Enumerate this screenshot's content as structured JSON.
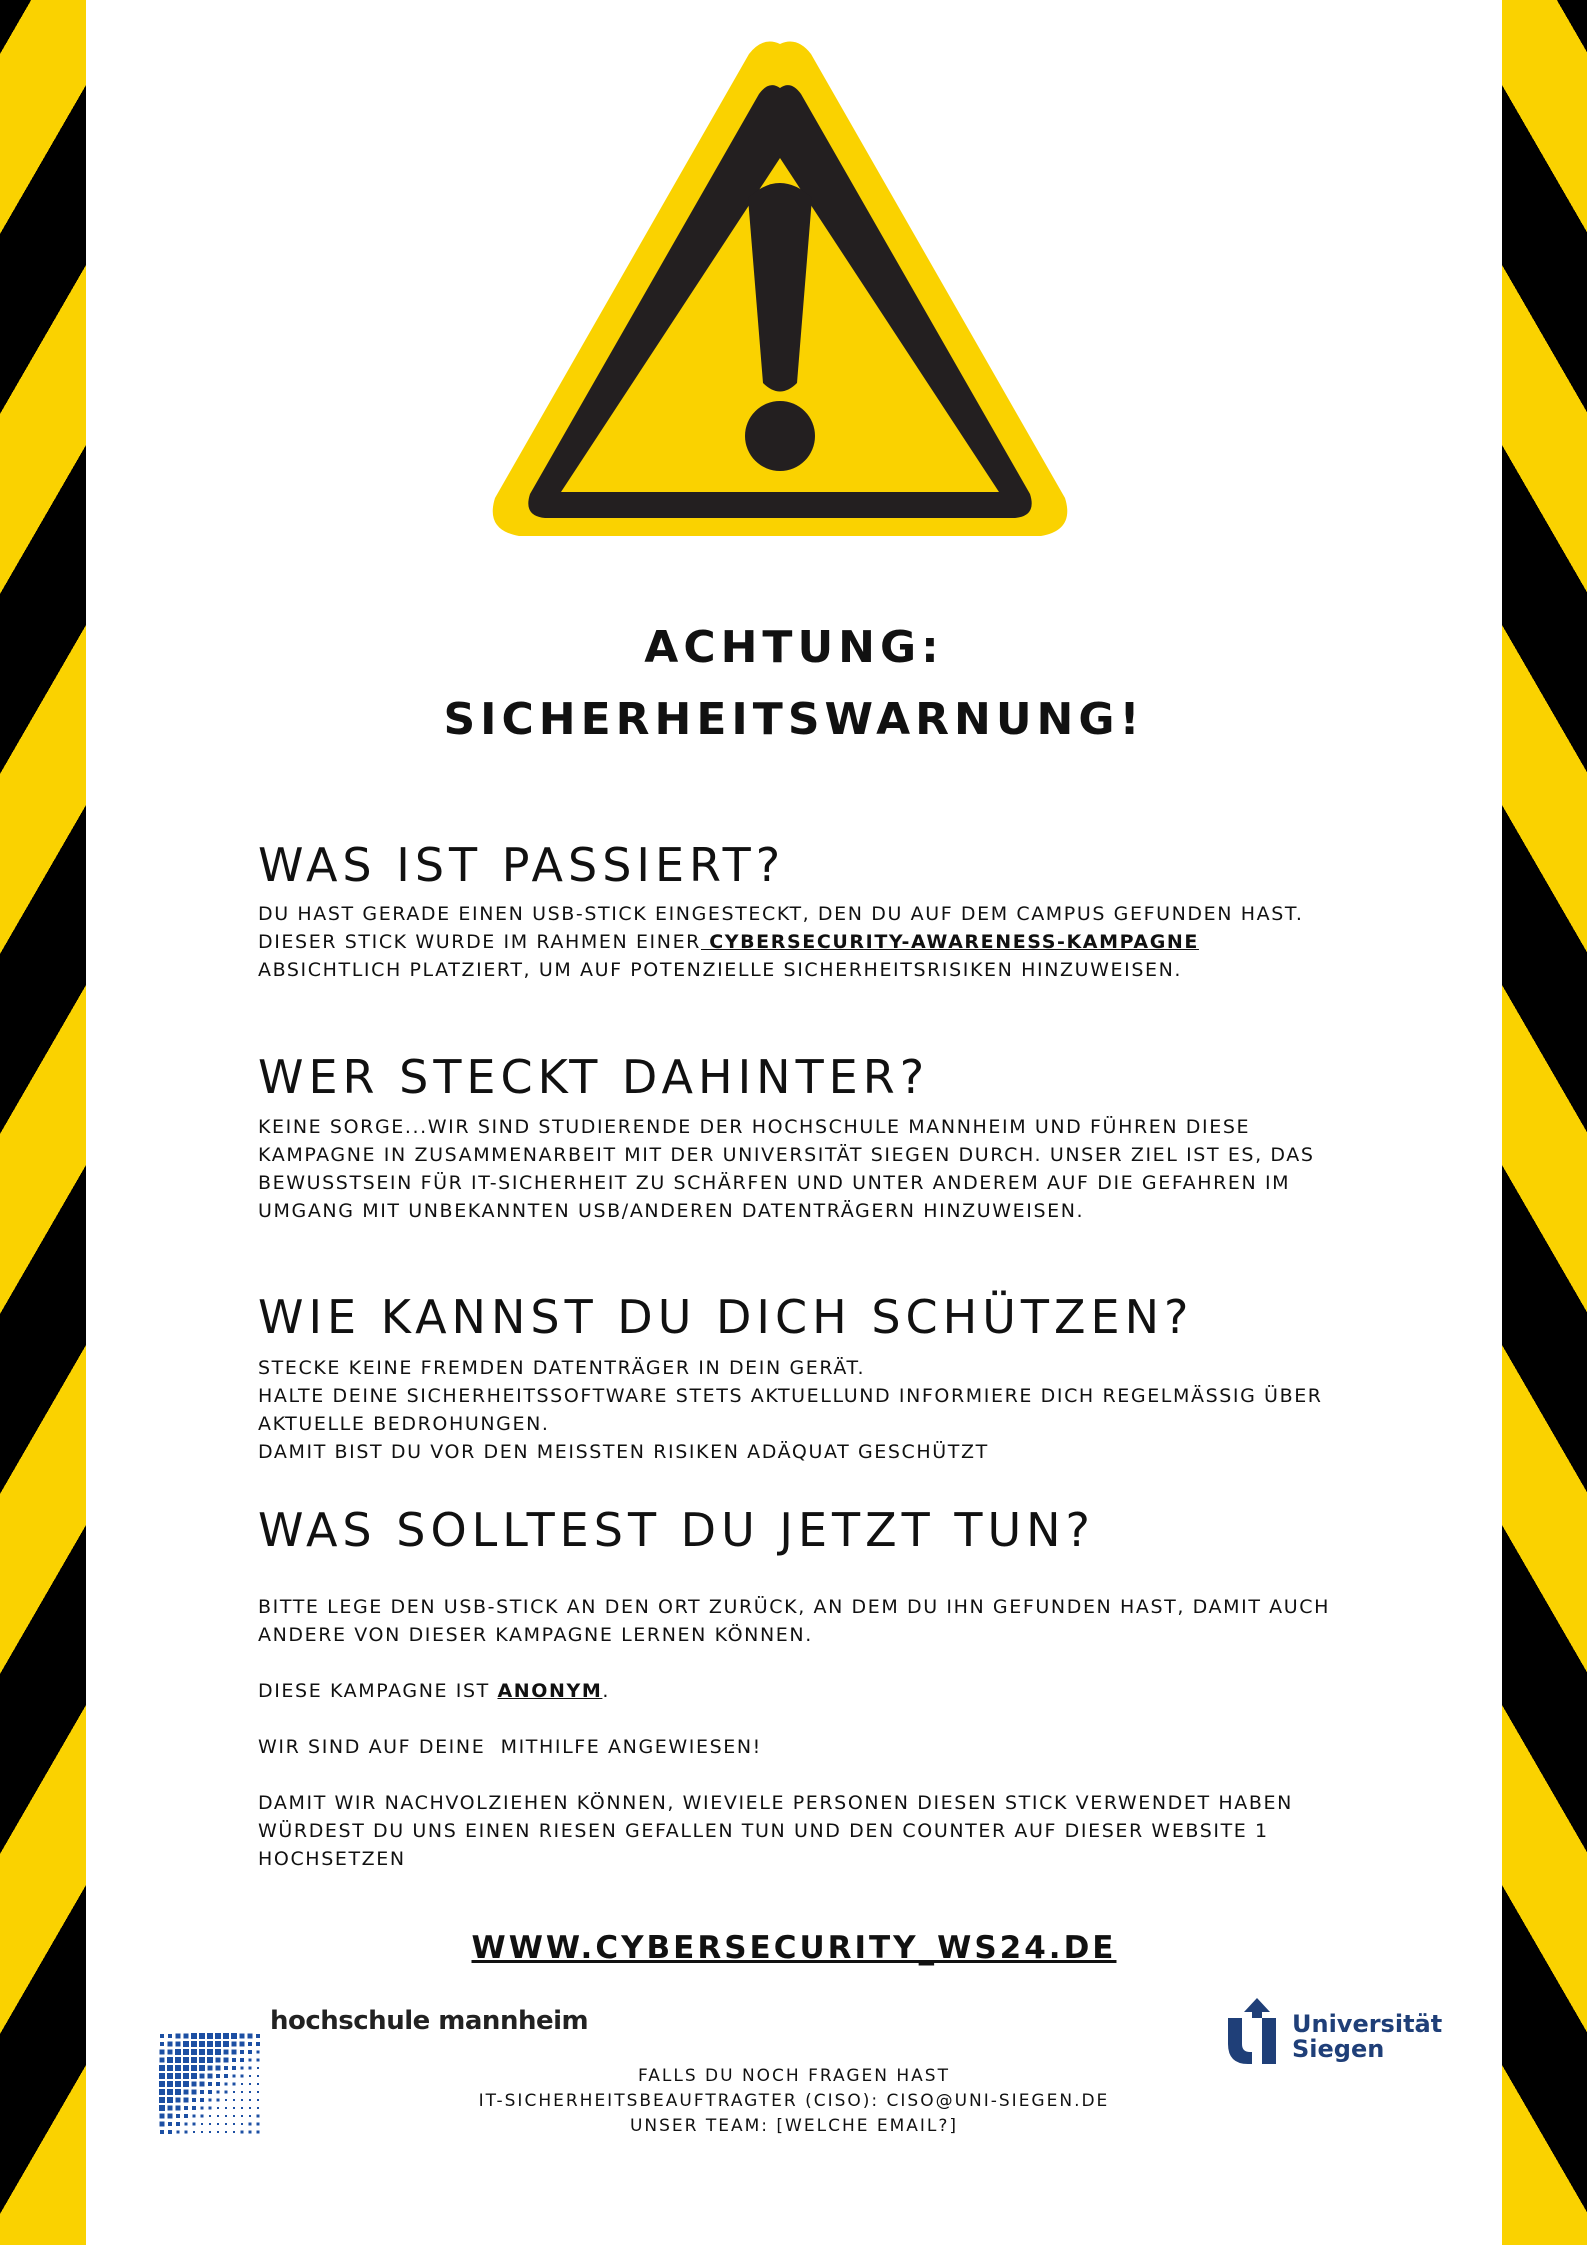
{
  "colors": {
    "warning_yellow": "#fad200",
    "stripe_black": "#000000",
    "siegen_blue": "#1f3f78",
    "mannheim_blue": "#1c4fa3"
  },
  "icons": {
    "warning": "warning-triangle-exclamation"
  },
  "title": {
    "line1": "ACHTUNG:",
    "line2": "SICHERHEITSWARNUNG!"
  },
  "sections": {
    "s1": {
      "heading": "WAS IST PASSIERT?",
      "text_before": "DU HAST GERADE EINEN USB-STICK EINGESTECKT, DEN DU AUF DEM CAMPUS GEFUNDEN HAST. DIESER STICK WURDE IM RAHMEN EINER",
      "link": " CYBERSECURITY-AWARENESS-KAMPAGNE",
      "text_after": " ABSICHTLICH PLATZIERT, UM AUF POTENZIELLE SICHERHEITSRISIKEN HINZUWEISEN."
    },
    "s2": {
      "heading": "WER STECKT DAHINTER?",
      "text": "KEINE SORGE...WIR SIND STUDIERENDE DER HOCHSCHULE MANNHEIM UND FÜHREN DIESE KAMPAGNE IN ZUSAMMENARBEIT MIT DER UNIVERSITÄT SIEGEN DURCH. UNSER ZIEL IST ES, DAS BEWUSSTSEIN FÜR IT-SICHERHEIT ZU SCHÄRFEN UND UNTER ANDEREM AUF DIE GEFAHREN IM UMGANG MIT UNBEKANNTEN USB/ANDEREN DATENTRÄGERN HINZUWEISEN."
    },
    "s3": {
      "heading": "WIE KANNST DU DICH SCHÜTZEN?",
      "line1": "STECKE KEINE FREMDEN DATENTRÄGER IN DEIN GERÄT.",
      "line2": "HALTE DEINE SICHERHEITSSOFTWARE STETS AKTUELLUND INFORMIERE DICH REGELMÄSSIG ÜBER AKTUELLE BEDROHUNGEN.",
      "line3": "DAMIT BIST DU VOR DEN MEISSTEN RISIKEN ADÄQUAT GESCHÜTZT"
    },
    "s4": {
      "heading": "WAS SOLLTEST DU JETZT TUN?",
      "p1": "BITTE LEGE DEN USB-STICK AN DEN ORT ZURÜCK, AN DEM DU IHN GEFUNDEN HAST, DAMIT AUCH ANDERE VON DIESER KAMPAGNE LERNEN KÖNNEN.",
      "p2_before": "DIESE KAMPAGNE IST ",
      "p2_link": "ANONYM",
      "p2_after": ".",
      "p3": "WIR SIND AUF DEINE  MITHILFE ANGEWIESEN!",
      "p4": "DAMIT WIR NACHVOLZIEHEN KÖNNEN, WIEVIELE PERSONEN DIESEN STICK VERWENDET HABEN WÜRDEST DU UNS EINEN RIESEN GEFALLEN TUN UND DEN COUNTER AUF DIESER WEBSITE 1 HOCHSETZEN"
    }
  },
  "website": "WWW.CYBERSECURITY_WS24.DE",
  "logos": {
    "mannheim": "hochschule mannheim",
    "siegen_line1": "Universität",
    "siegen_line2": "Siegen"
  },
  "footer": {
    "line1": "FALLS DU NOCH FRAGEN HAST",
    "line2": "IT-SICHERHEITSBEAUFTRAGTER (CISO): CISO@UNI-SIEGEN.DE",
    "line3": "UNSER TEAM: [WELCHE EMAIL?]"
  }
}
